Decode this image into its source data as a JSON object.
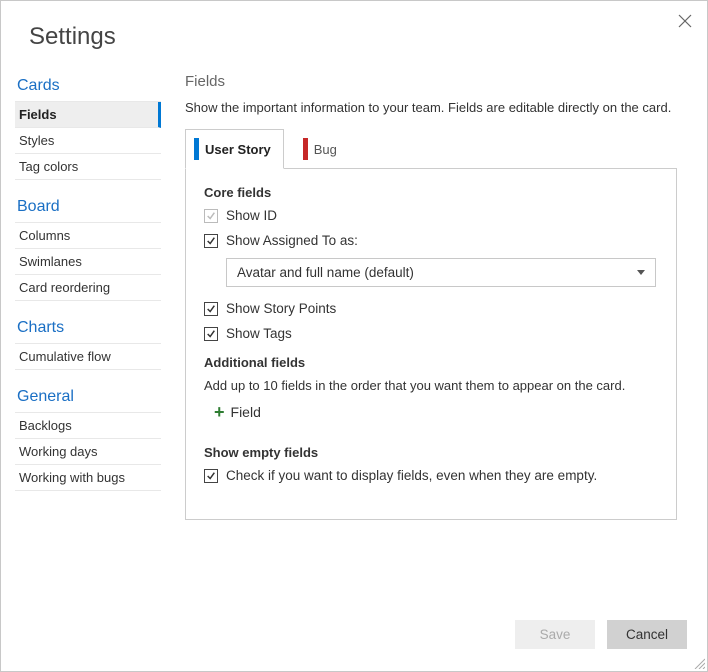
{
  "title": "Settings",
  "sidebar": {
    "sections": [
      {
        "title": "Cards",
        "items": [
          {
            "label": "Fields",
            "active": true
          },
          {
            "label": "Styles"
          },
          {
            "label": "Tag colors"
          }
        ]
      },
      {
        "title": "Board",
        "items": [
          {
            "label": "Columns"
          },
          {
            "label": "Swimlanes"
          },
          {
            "label": "Card reordering"
          }
        ]
      },
      {
        "title": "Charts",
        "items": [
          {
            "label": "Cumulative flow"
          }
        ]
      },
      {
        "title": "General",
        "items": [
          {
            "label": "Backlogs"
          },
          {
            "label": "Working days"
          },
          {
            "label": "Working with bugs"
          }
        ]
      }
    ]
  },
  "main": {
    "page_title": "Fields",
    "page_desc": "Show the important information to your team. Fields are editable directly on the card.",
    "tabs": [
      {
        "label": "User Story",
        "color": "#0078d4",
        "active": true
      },
      {
        "label": "Bug",
        "color": "#c62828",
        "active": false
      }
    ],
    "core_title": "Core fields",
    "core": [
      {
        "label": "Show ID",
        "checked": true,
        "disabled": true
      },
      {
        "label": "Show Assigned To as:",
        "checked": true
      }
    ],
    "assigned_to_value": "Avatar and full name (default)",
    "core2": [
      {
        "label": "Show Story Points",
        "checked": true
      },
      {
        "label": "Show Tags",
        "checked": true
      }
    ],
    "additional_title": "Additional fields",
    "additional_desc": "Add up to 10 fields in the order that you want them to appear on the card.",
    "add_field_label": "Field",
    "empty_title": "Show empty fields",
    "empty_label": "Check if you want to display fields, even when they are empty.",
    "empty_checked": true
  },
  "footer": {
    "save": "Save",
    "cancel": "Cancel"
  }
}
